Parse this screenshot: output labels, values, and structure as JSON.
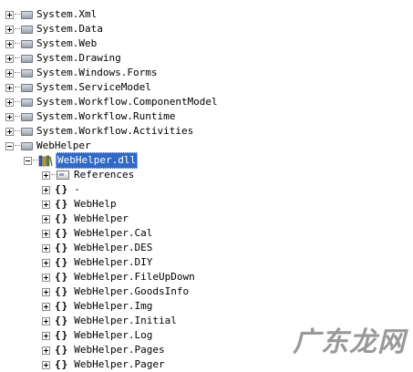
{
  "tree": {
    "namespaces": [
      "System.Xml",
      "System.Data",
      "System.Web",
      "System.Drawing",
      "System.Windows.Forms",
      "System.ServiceModel",
      "System.Workflow.ComponentModel",
      "System.Workflow.Runtime",
      "System.Workflow.Activities"
    ],
    "project": "WebHelper",
    "assembly": "WebHelper.dll",
    "references": "References",
    "brace_glyph": "{}",
    "child_namespaces": [
      "-",
      "WebHelp",
      "WebHelper",
      "WebHelper.Cal",
      "WebHelper.DES",
      "WebHelper.DIY",
      "WebHelper.FileUpDown",
      "WebHelper.GoodsInfo",
      "WebHelper.Img",
      "WebHelper.Initial",
      "WebHelper.Log",
      "WebHelper.Pages",
      "WebHelper.Pager"
    ]
  },
  "watermark": "广东龙网"
}
